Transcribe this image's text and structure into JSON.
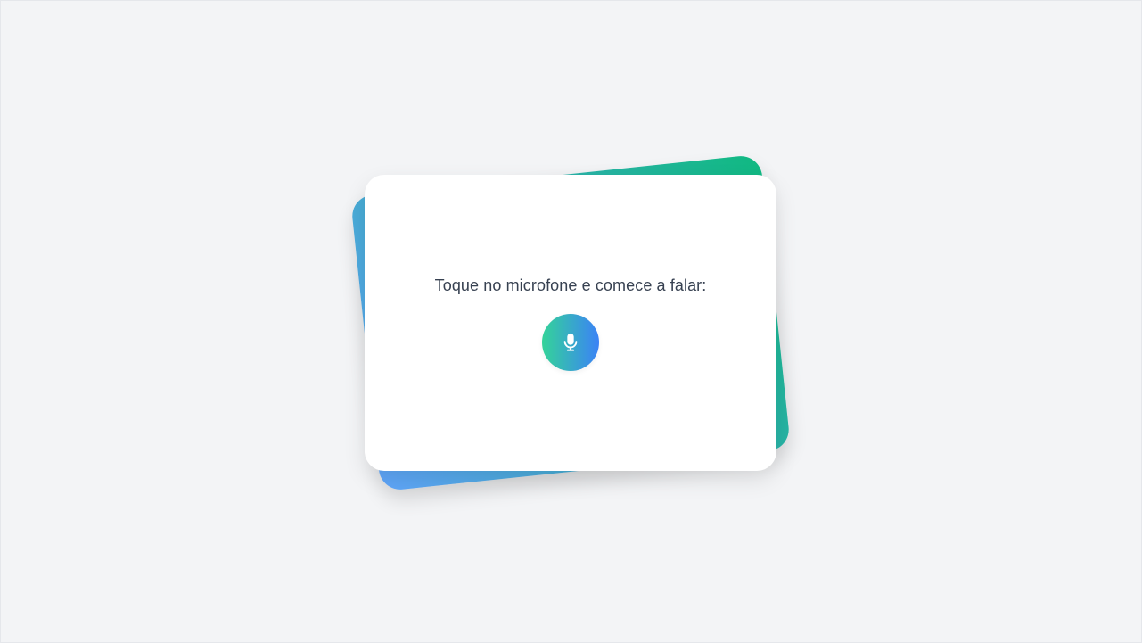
{
  "card": {
    "prompt_text": "Toque no microfone e comece a falar:"
  },
  "mic_button": {
    "icon": "microphone-icon",
    "aria_label": "microfone"
  },
  "colors": {
    "page_background": "#f3f4f6",
    "card_background": "#ffffff",
    "text": "#374151",
    "gradient_blue": "#60a5fa",
    "gradient_green": "#10b981",
    "mic_gradient_start": "#34d399",
    "mic_gradient_end": "#3b82f6"
  }
}
